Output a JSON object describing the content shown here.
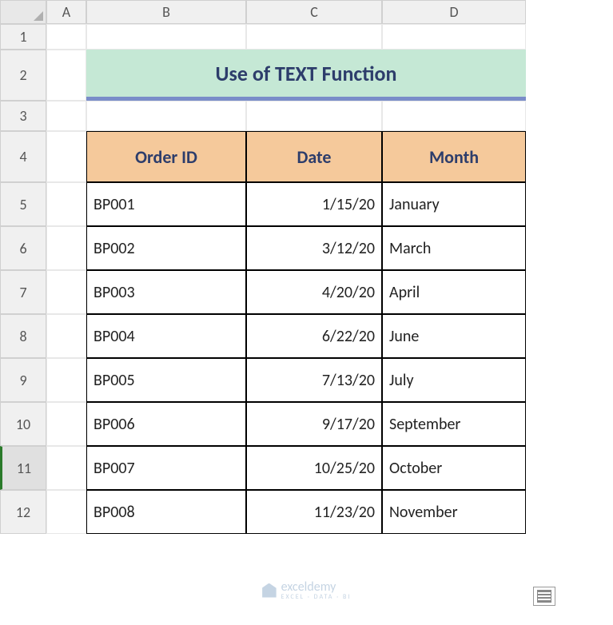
{
  "columns": [
    "A",
    "B",
    "C",
    "D"
  ],
  "rows": [
    "1",
    "2",
    "3",
    "4",
    "5",
    "6",
    "7",
    "8",
    "9",
    "10",
    "11",
    "12"
  ],
  "selected_row": "11",
  "title": "Use of TEXT Function",
  "headers": {
    "col1": "Order ID",
    "col2": "Date",
    "col3": "Month"
  },
  "data": [
    {
      "id": "BP001",
      "date": "1/15/20",
      "month": "January"
    },
    {
      "id": "BP002",
      "date": "3/12/20",
      "month": "March"
    },
    {
      "id": "BP003",
      "date": "4/20/20",
      "month": "April"
    },
    {
      "id": "BP004",
      "date": "6/22/20",
      "month": "June"
    },
    {
      "id": "BP005",
      "date": "7/13/20",
      "month": "July"
    },
    {
      "id": "BP006",
      "date": "9/17/20",
      "month": "September"
    },
    {
      "id": "BP007",
      "date": "10/25/20",
      "month": "October"
    },
    {
      "id": "BP008",
      "date": "11/23/20",
      "month": "November"
    }
  ],
  "watermark": {
    "brand": "exceldemy",
    "tagline": "EXCEL · DATA · BI"
  },
  "chart_data": {
    "type": "table",
    "title": "Use of TEXT Function",
    "columns": [
      "Order ID",
      "Date",
      "Month"
    ],
    "rows": [
      [
        "BP001",
        "1/15/20",
        "January"
      ],
      [
        "BP002",
        "3/12/20",
        "March"
      ],
      [
        "BP003",
        "4/20/20",
        "April"
      ],
      [
        "BP004",
        "6/22/20",
        "June"
      ],
      [
        "BP005",
        "7/13/20",
        "July"
      ],
      [
        "BP006",
        "9/17/20",
        "September"
      ],
      [
        "BP007",
        "10/25/20",
        "October"
      ],
      [
        "BP008",
        "11/23/20",
        "November"
      ]
    ]
  }
}
